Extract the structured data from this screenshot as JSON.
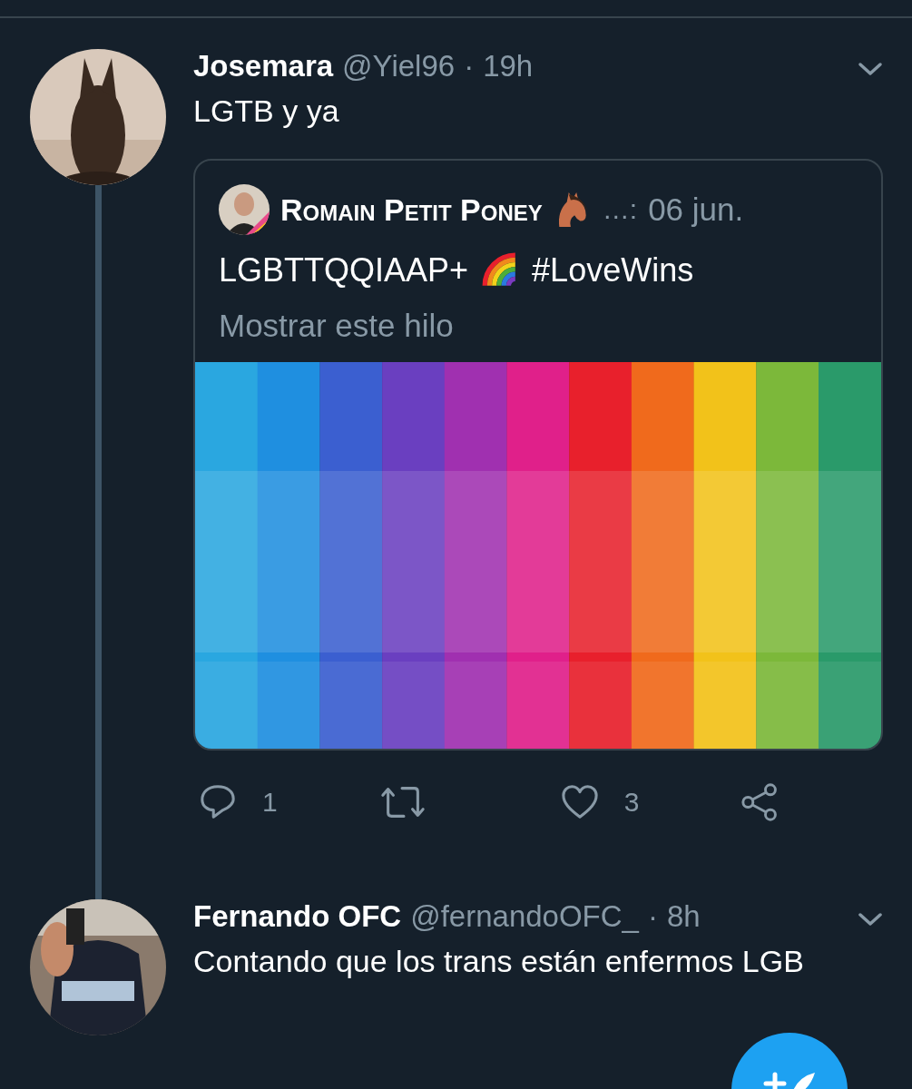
{
  "tweets": [
    {
      "name": "Josemara",
      "handle": "@Yiel96",
      "separator": "·",
      "time": "19h",
      "text": "LGTB y ya",
      "kind": "quoting",
      "quote": {
        "name": "Romain Petit Poney",
        "truncation": "…:",
        "date": "06 jun.",
        "text_before": "LGBTTQQIAAP+",
        "text_after": "#LoveWins",
        "thread_link": "Mostrar este hilo"
      },
      "actions": {
        "replies": "1",
        "likes": "3"
      }
    },
    {
      "name": "Fernando OFC",
      "handle": "@fernandoOFC_",
      "separator": "·",
      "time": "8h",
      "text": "Contando que los trans están enfermos LGB",
      "kind": "plain"
    }
  ]
}
